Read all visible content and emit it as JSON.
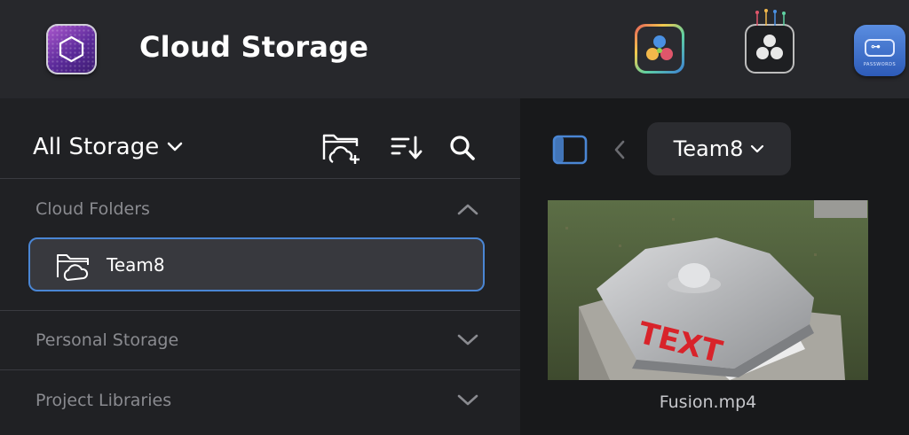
{
  "header": {
    "title": "Cloud Storage",
    "app_icons": [
      "cloud-storage-app-icon",
      "davinci-resolve-icon",
      "davinci-resolve-dev-icon",
      "keys-app-icon"
    ],
    "keys_icon_text": "PASSWORDS"
  },
  "sidebar": {
    "storage_select_label": "All Storage",
    "sections": [
      {
        "label": "Cloud Folders",
        "state": "expanded"
      },
      {
        "label": "Personal Storage",
        "state": "collapsed"
      },
      {
        "label": "Project Libraries",
        "state": "collapsed"
      }
    ],
    "folders": [
      {
        "label": "Team8",
        "selected": true
      }
    ]
  },
  "browser": {
    "breadcrumb": "Team8",
    "files": [
      {
        "name": "Fusion.mp4",
        "thumbnail_text": "TEXT"
      }
    ]
  },
  "colors": {
    "accent": "#4a86d4",
    "header_bg": "#27282c",
    "panel_bg": "#202124",
    "browser_bg": "#18191b"
  }
}
